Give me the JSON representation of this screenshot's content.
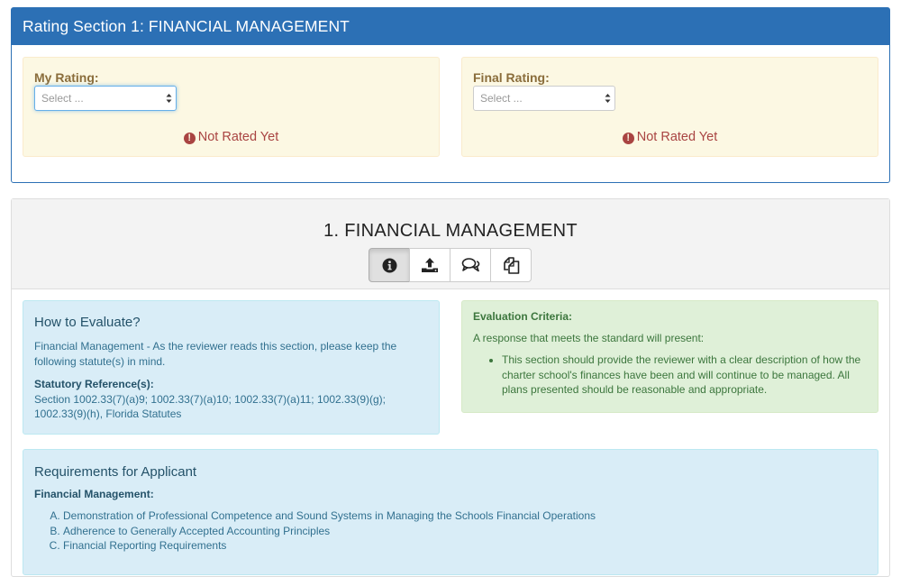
{
  "rating_section": {
    "title": "Rating Section 1: FINANCIAL MANAGEMENT",
    "my_rating": {
      "label": "My Rating:",
      "select_value": "Select ...",
      "status": "Not Rated Yet"
    },
    "final_rating": {
      "label": "Final Rating:",
      "select_value": "Select ...",
      "status": "Not Rated Yet"
    }
  },
  "section": {
    "title": "1. FINANCIAL MANAGEMENT",
    "toolbar_icons": [
      "info-icon",
      "upload-icon",
      "comments-icon",
      "copy-icon"
    ],
    "how_to_evaluate": {
      "heading": "How to Evaluate?",
      "text": "Financial Management - As the reviewer reads this section, please keep the following statute(s) in mind.",
      "ref_label": "Statutory Reference(s):",
      "ref_text": "Section 1002.33(7)(a)9; 1002.33(7)(a)10; 1002.33(7)(a)11; 1002.33(9)(g); 1002.33(9)(h), Florida Statutes"
    },
    "evaluation_criteria": {
      "title": "Evaluation Criteria:",
      "intro": "A response that meets the standard will present:",
      "items": [
        "This section should provide the reviewer with a clear description of how the charter school's finances have been and will continue to be managed. All plans presented should be reasonable and appropriate."
      ]
    },
    "requirements": {
      "heading": "Requirements for Applicant",
      "subheading": "Financial Management:",
      "items": [
        "Demonstration of Professional Competence and Sound Systems in Managing the Schools Financial Operations",
        "Adherence to Generally Accepted Accounting Principles",
        "Financial Reporting Requirements"
      ]
    }
  },
  "colors": {
    "primary": "#2c70b5",
    "warning_bg": "#fcf8e3",
    "danger_text": "#a94442",
    "info_bg": "#d9edf7",
    "success_bg": "#dff0d8"
  }
}
